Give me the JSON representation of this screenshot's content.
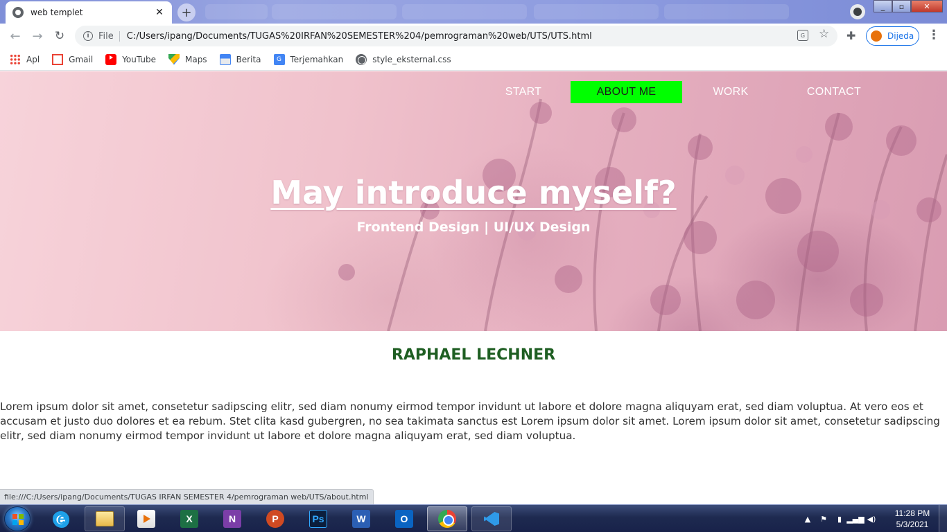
{
  "browser": {
    "tab_title": "web templet",
    "tab_close": "✕",
    "new_tab": "+",
    "url_scheme": "File",
    "url": "C:/Users/ipang/Documents/TUGAS%20IRFAN%20SEMESTER%204/pemrograman%20web/UTS/UTS.html",
    "profile_status": "Dijeda",
    "status_url": "file:///C:/Users/ipang/Documents/TUGAS IRFAN SEMESTER 4/pemrograman web/UTS/about.html",
    "bookmarks": [
      {
        "label": "Apl",
        "icon": "apps-grid-icon"
      },
      {
        "label": "Gmail",
        "icon": "gmail-icon"
      },
      {
        "label": "YouTube",
        "icon": "youtube-icon"
      },
      {
        "label": "Maps",
        "icon": "maps-icon"
      },
      {
        "label": "Berita",
        "icon": "news-icon"
      },
      {
        "label": "Terjemahkan",
        "icon": "translate-icon"
      },
      {
        "label": "style_eksternal.css",
        "icon": "globe-icon"
      }
    ]
  },
  "page": {
    "nav": {
      "start": "START",
      "about": "ABOUT ME",
      "work": "WORK",
      "contact": "CONTACT",
      "active_color": "#00ff00"
    },
    "hero_title": "May introduce myself?",
    "hero_subtitle": "Frontend Design | UI/UX Design",
    "name": "RAPHAEL LECHNER",
    "body_text": "Lorem ipsum dolor sit amet, consetetur sadipscing elitr, sed diam nonumy eirmod tempor invidunt ut labore et dolore magna aliquyam erat, sed diam voluptua. At vero eos et accusam et justo duo dolores et ea rebum. Stet clita kasd gubergren, no sea takimata sanctus est Lorem ipsum dolor sit amet. Lorem ipsum dolor sit amet, consetetur sadipscing elitr, sed diam nonumy eirmod tempor invidunt ut labore et dolore magna aliquyam erat, sed diam voluptua.",
    "name_color": "#1e5e22"
  },
  "taskbar": {
    "apps": [
      "internet-explorer",
      "file-explorer",
      "media-player",
      "excel",
      "onenote",
      "powerpoint",
      "photoshop",
      "word",
      "outlook",
      "chrome",
      "vscode"
    ],
    "time": "11:28 PM",
    "date": "5/3/2021"
  }
}
